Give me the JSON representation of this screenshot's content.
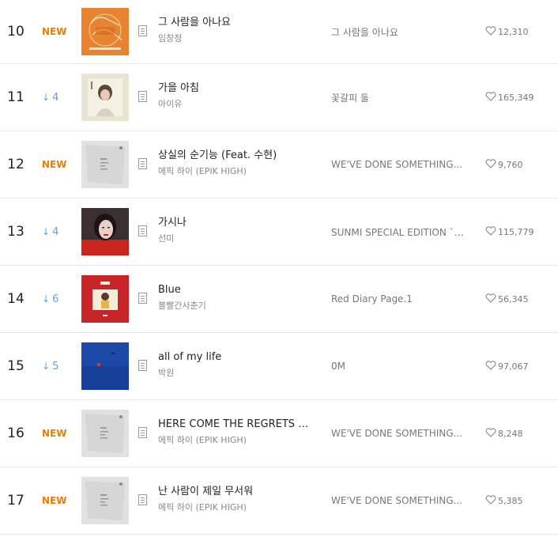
{
  "rows": [
    {
      "rank": "10",
      "change_type": "new",
      "change_text": "NEW",
      "title": "그 사람을 아나요",
      "artist": "임창정",
      "album": "그 사람을 아나요",
      "likes": "12,310",
      "cover": "orange"
    },
    {
      "rank": "11",
      "change_type": "down",
      "change_text": "4",
      "title": "가을 아침",
      "artist": "아이유",
      "album": "꽃갈피 둘",
      "likes": "165,349",
      "cover": "iu"
    },
    {
      "rank": "12",
      "change_type": "new",
      "change_text": "NEW",
      "title": "상실의 순기능 (Feat. 수현)",
      "artist": "에픽 하이 (EPIK HIGH)",
      "album": "WE'VE DONE SOMETHING...",
      "likes": "9,760",
      "cover": "epik"
    },
    {
      "rank": "13",
      "change_type": "down",
      "change_text": "4",
      "title": "가시나",
      "artist": "선미",
      "album": "SUNMI SPECIAL EDITION `가...",
      "likes": "115,779",
      "cover": "sunmi"
    },
    {
      "rank": "14",
      "change_type": "down",
      "change_text": "6",
      "title": "Blue",
      "artist": "볼빨간사춘기",
      "album": "Red Diary Page.1",
      "likes": "56,345",
      "cover": "bol4"
    },
    {
      "rank": "15",
      "change_type": "down",
      "change_text": "5",
      "title": "all of my life",
      "artist": "박원",
      "album": "0M",
      "likes": "97,067",
      "cover": "blue"
    },
    {
      "rank": "16",
      "change_type": "new",
      "change_text": "NEW",
      "title": "HERE COME THE REGRETS (Feat...",
      "artist": "에픽 하이 (EPIK HIGH)",
      "album": "WE'VE DONE SOMETHING...",
      "likes": "8,248",
      "cover": "epik"
    },
    {
      "rank": "17",
      "change_type": "new",
      "change_text": "NEW",
      "title": "난 사람이 제일 무서워",
      "artist": "에픽 하이 (EPIK HIGH)",
      "album": "WE'VE DONE SOMETHING...",
      "likes": "5,385",
      "cover": "epik"
    }
  ],
  "colors": {
    "new": "#ec7d00",
    "down": "#5fa0e6"
  },
  "icons": {
    "change_down": "arrow-down-icon",
    "lyrics": "document-icon",
    "like": "heart-icon"
  }
}
